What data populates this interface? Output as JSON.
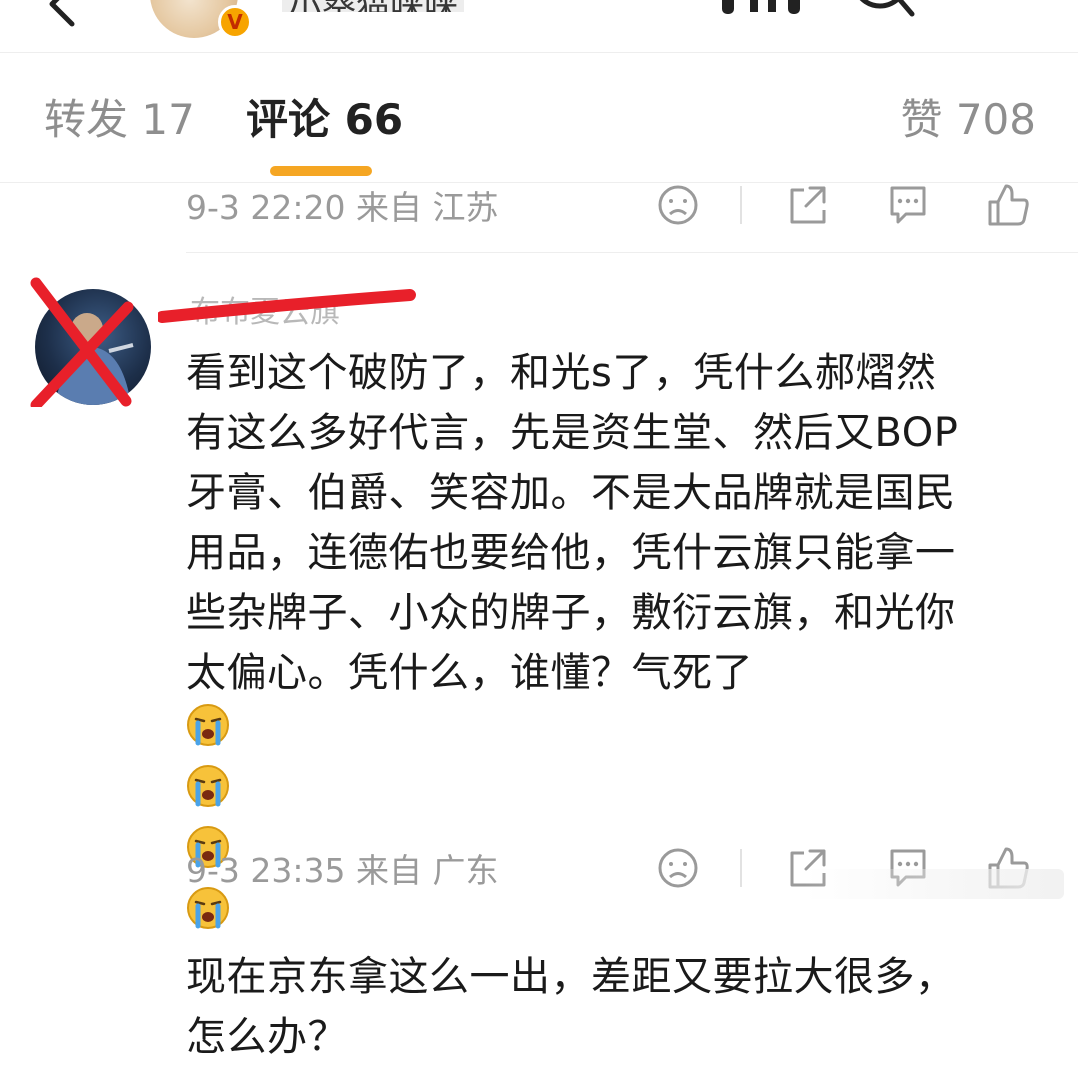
{
  "header": {
    "author_name": "小葵猫咪咪",
    "verified_badge": "V"
  },
  "tabs": {
    "reposts": "转发 17",
    "comments": "评论 66",
    "likes": "赞 708"
  },
  "previous_comment": {
    "meta": "9-3 22:20 来自 江苏"
  },
  "comment": {
    "username": "布布夏云旗",
    "lines": [
      "看到这个破防了，和光s了，凭什么郝熠然",
      "有这么多好代言，先是资生堂、然后又BOP",
      "牙膏、伯爵、笑容加。不是大品牌就是国民",
      "用品，连德佑也要给他，凭什云旗只能拿一",
      "些杂牌子、小众的牌子，敷衍云旗，和光你",
      "太偏心。凭什么，谁懂？气死了",
      "现在京东拿这么一出，差距又要拉大很多，",
      "怎么办？"
    ],
    "emoji_count": 4,
    "meta": "9-3 23:35 来自 广东"
  },
  "colors": {
    "accent": "#f5a623",
    "meta_text": "#9a9a9a",
    "redaction": "#e8202a",
    "badge": "#f7a400"
  },
  "icons": [
    "back-icon",
    "music-icon",
    "search-icon",
    "dislike-face-icon",
    "share-icon",
    "comment-icon",
    "like-thumb-icon",
    "crying-emoji-icon"
  ]
}
